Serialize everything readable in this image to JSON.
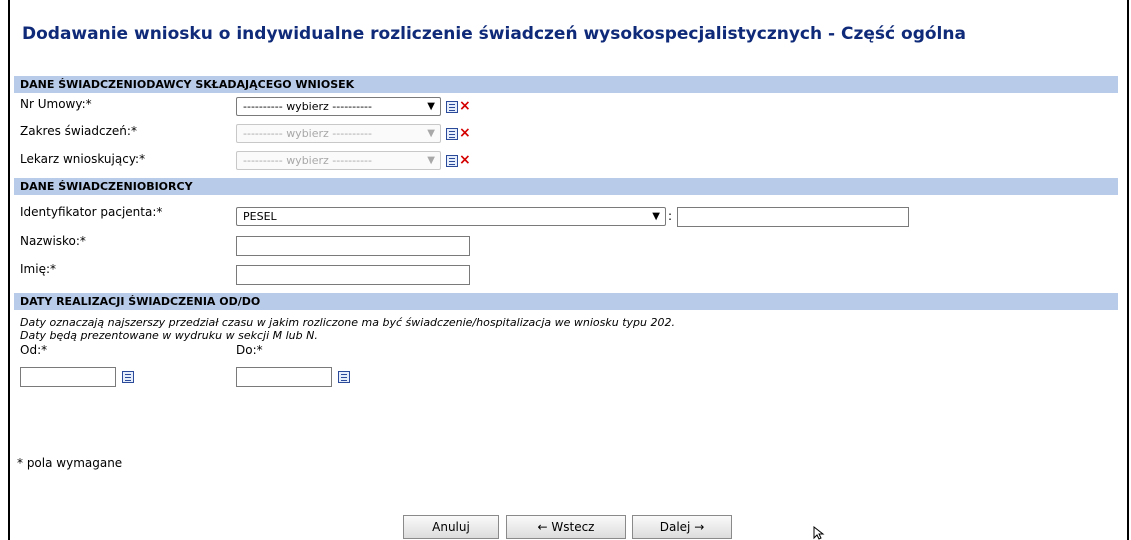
{
  "title": "Dodawanie wniosku o indywidualne rozliczenie świadczeń wysokospecjalistycznych - Część ogólna",
  "sections": {
    "provider": "DANE ŚWIADCZENIODAWCY SKŁADAJĄCEGO WNIOSEK",
    "patient": "DANE ŚWIADCZENIOBIORCY",
    "dates": "DATY REALIZACJI ŚWIADCZENIA OD/DO"
  },
  "provider": {
    "contract_label": "Nr Umowy:*",
    "contract_value": "---------- wybierz ----------",
    "scope_label": "Zakres świadczeń:*",
    "scope_value": "---------- wybierz ----------",
    "doctor_label": "Lekarz wnioskujący:*",
    "doctor_value": "---------- wybierz ----------"
  },
  "patient": {
    "id_label": "Identyfikator pacjenta:*",
    "id_type": "PESEL",
    "id_sep": ":",
    "id_value": "",
    "surname_label": "Nazwisko:*",
    "surname_value": "",
    "name_label": "Imię:*",
    "name_value": ""
  },
  "dates": {
    "note1": "Daty oznaczają najszerszy przedział czasu w jakim rozliczone ma być świadczenie/hospitalizacja we wniosku typu 202.",
    "note2": "Daty będą prezentowane w wydruku w sekcji M lub N.",
    "from_label": "Od:*",
    "from_value": "",
    "to_label": "Do:*",
    "to_value": ""
  },
  "required_note": "* pola wymagane",
  "buttons": {
    "cancel": "Anuluj",
    "back": "← Wstecz",
    "next": "Dalej →"
  }
}
